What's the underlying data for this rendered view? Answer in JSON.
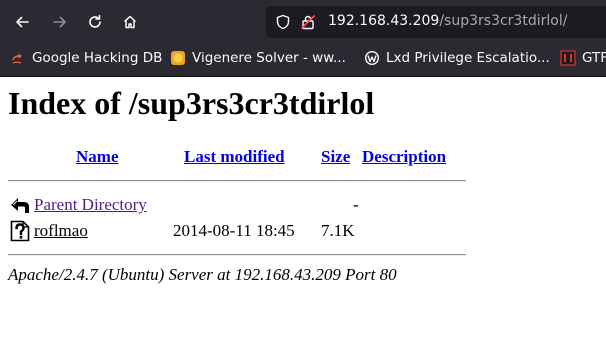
{
  "browser": {
    "url_host": "192.168.43.209",
    "url_path": "/sup3rs3cr3tdirlol/",
    "bookmarks": [
      {
        "label": "Google Hacking DB"
      },
      {
        "label": "Vigenere Solver - ww..."
      },
      {
        "label": "Lxd Privilege Escalatio..."
      },
      {
        "label": "GTF"
      }
    ]
  },
  "page": {
    "title": "Index of /sup3rs3cr3tdirlol",
    "columns": [
      "Name",
      "Last modified",
      "Size",
      "Description"
    ],
    "rows": [
      {
        "name": "Parent Directory",
        "modified": "",
        "size": "-",
        "description": "",
        "icon": "back-arrow-icon"
      },
      {
        "name": "roflmao",
        "modified": "2014-08-11 18:45",
        "size": "7.1K",
        "description": "",
        "icon": "unknown-file-icon"
      }
    ],
    "footer": "Apache/2.4.7 (Ubuntu) Server at 192.168.43.209 Port 80"
  }
}
